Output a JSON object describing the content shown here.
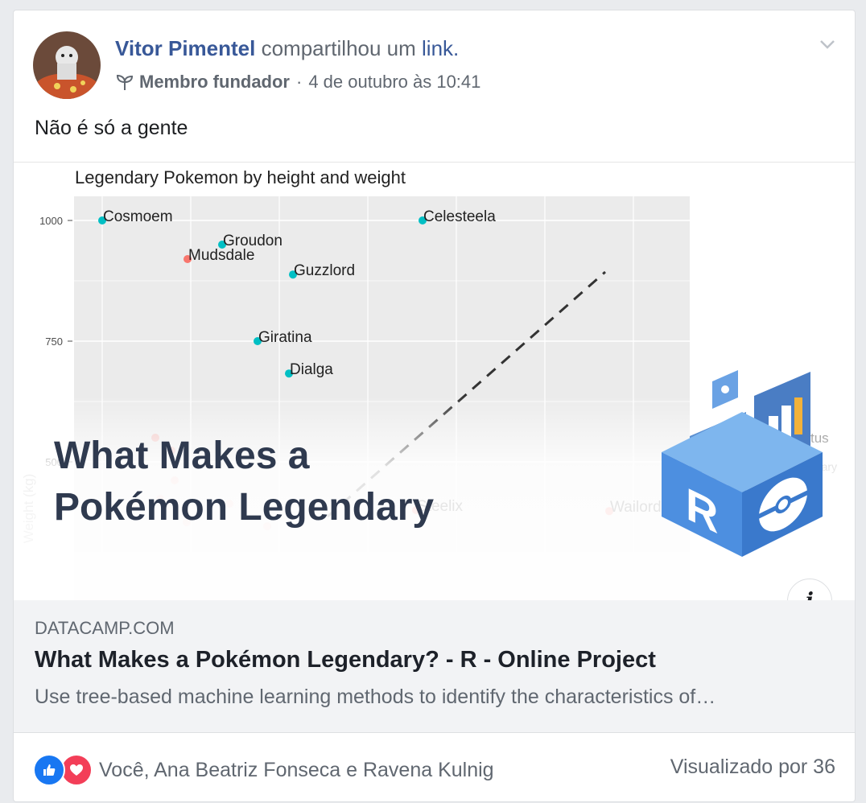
{
  "post": {
    "author": "Vitor Pimentel",
    "action_text": "compartilhou um",
    "action_link": "link.",
    "badge": "Membro fundador",
    "separator": "·",
    "timestamp": "4 de outubro às 10:41",
    "text": "Não é só a gente"
  },
  "preview": {
    "headline_line1": "What Makes a",
    "headline_line2": "Pokémon Legendary",
    "info_label": "i"
  },
  "chart_data": {
    "type": "scatter",
    "title": "Legendary Pokemon by height and weight",
    "ylabel": "Weight (kg)",
    "yticks": [
      "1000",
      "750",
      "500"
    ],
    "points": [
      {
        "label": "Cosmoem",
        "y": 1000,
        "color": "#00bfc4"
      },
      {
        "label": "Celesteela",
        "y": 1000,
        "color": "#00bfc4"
      },
      {
        "label": "Groudon",
        "y": 950,
        "color": "#00bfc4"
      },
      {
        "label": "Mudsdale",
        "y": 920,
        "color": "#f8766d"
      },
      {
        "label": "Guzzlord",
        "y": 888,
        "color": "#00bfc4"
      },
      {
        "label": "Giratina",
        "y": 750,
        "color": "#00bfc4"
      },
      {
        "label": "Dialga",
        "y": 683,
        "color": "#00bfc4"
      },
      {
        "label": "Steelix",
        "y": 400,
        "color": "#f8766d"
      },
      {
        "label": "Wailord",
        "y": 398,
        "color": "#f8766d"
      }
    ],
    "partial_labels": [
      "tus",
      "ndary"
    ],
    "colors": {
      "legendary": "#00bfc4",
      "non_legendary": "#f8766d"
    }
  },
  "link": {
    "domain": "DATACAMP.COM",
    "title": "What Makes a Pokémon Legendary? - R - Online Project",
    "description": "Use tree-based machine learning methods to identify the characteristics of…"
  },
  "footer": {
    "reactions": "Você, Ana Beatriz Fonseca e Ravena Kulnig",
    "views": "Visualizado por 36"
  },
  "colors": {
    "link_blue": "#385898",
    "muted_text": "#606770",
    "like_blue": "#1877f2",
    "love_red": "#f33e58"
  }
}
